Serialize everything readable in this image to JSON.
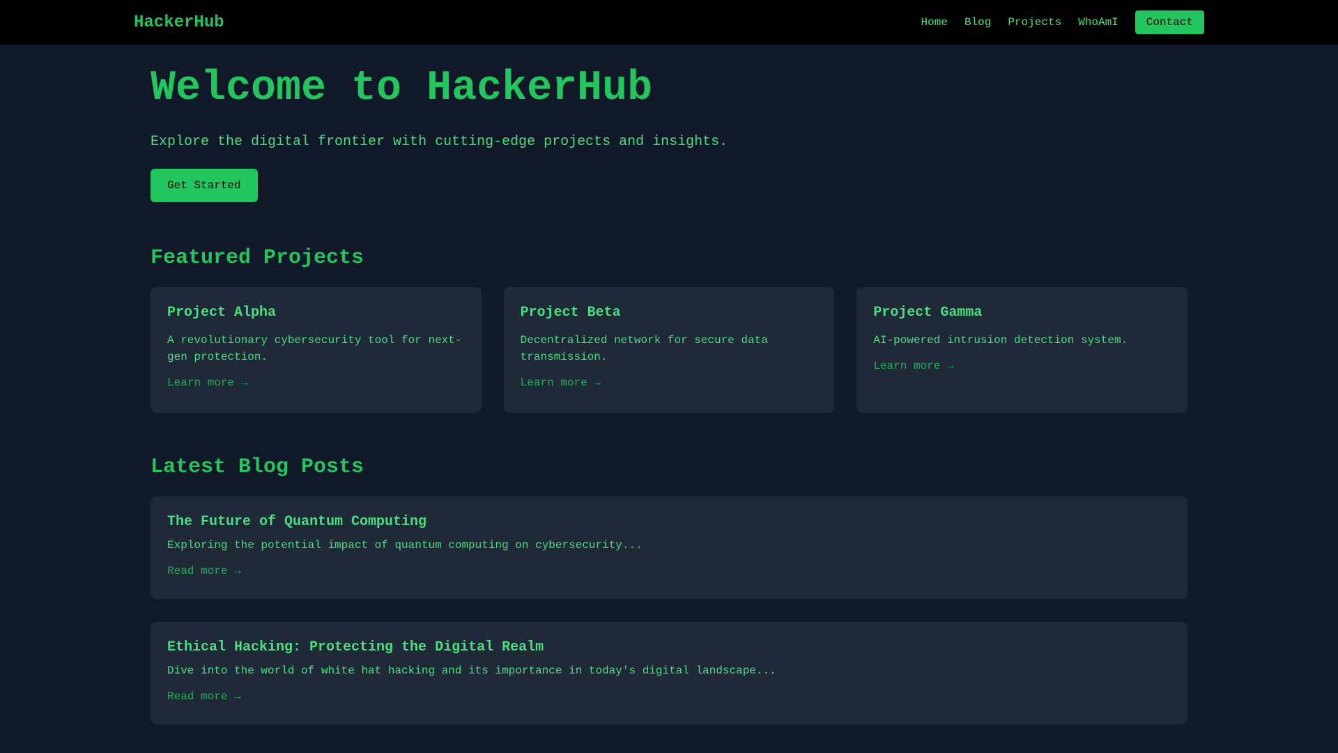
{
  "header": {
    "brand": "HackerHub",
    "nav": [
      {
        "label": "Home"
      },
      {
        "label": "Blog"
      },
      {
        "label": "Projects"
      },
      {
        "label": "WhoAmI"
      }
    ],
    "contact_label": "Contact"
  },
  "hero": {
    "title": "Welcome to HackerHub",
    "subtitle": "Explore the digital frontier with cutting-edge projects and insights.",
    "cta_label": "Get Started"
  },
  "projects": {
    "title": "Featured Projects",
    "items": [
      {
        "title": "Project Alpha",
        "description": "A revolutionary cybersecurity tool for next-gen protection.",
        "link": "Learn more →"
      },
      {
        "title": "Project Beta",
        "description": "Decentralized network for secure data transmission.",
        "link": "Learn more →"
      },
      {
        "title": "Project Gamma",
        "description": "AI-powered intrusion detection system.",
        "link": "Learn more →"
      }
    ]
  },
  "blog": {
    "title": "Latest Blog Posts",
    "posts": [
      {
        "title": "The Future of Quantum Computing",
        "excerpt": "Exploring the potential impact of quantum computing on cybersecurity...",
        "link": "Read more →"
      },
      {
        "title": "Ethical Hacking: Protecting the Digital Realm",
        "excerpt": "Dive into the world of white hat hacking and its importance in today's digital landscape...",
        "link": "Read more →"
      }
    ]
  },
  "colors": {
    "background": "#111827",
    "header_bg": "#000000",
    "card_bg": "#1f2937",
    "accent": "#22c55e",
    "text": "#4ade80"
  }
}
